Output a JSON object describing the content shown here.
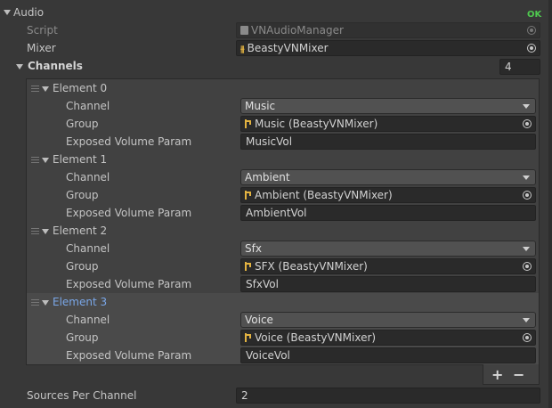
{
  "header": {
    "title": "Audio",
    "status": "OK"
  },
  "script_field": {
    "label": "Script",
    "value": "VNAudioManager"
  },
  "mixer_field": {
    "label": "Mixer",
    "value": "BeastyVNMixer"
  },
  "channels": {
    "label": "Channels",
    "size": "4",
    "elements": [
      {
        "title": "Element 0",
        "channel_label": "Channel",
        "channel": "Music",
        "group_label": "Group",
        "group": "Music (BeastyVNMixer)",
        "param_label": "Exposed Volume Param",
        "param": "MusicVol"
      },
      {
        "title": "Element 1",
        "channel_label": "Channel",
        "channel": "Ambient",
        "group_label": "Group",
        "group": "Ambient (BeastyVNMixer)",
        "param_label": "Exposed Volume Param",
        "param": "AmbientVol"
      },
      {
        "title": "Element 2",
        "channel_label": "Channel",
        "channel": "Sfx",
        "group_label": "Group",
        "group": "SFX (BeastyVNMixer)",
        "param_label": "Exposed Volume Param",
        "param": "SfxVol"
      },
      {
        "title": "Element 3",
        "channel_label": "Channel",
        "channel": "Voice",
        "group_label": "Group",
        "group": "Voice (BeastyVNMixer)",
        "param_label": "Exposed Volume Param",
        "param": "VoiceVol"
      }
    ],
    "add_label": "+",
    "remove_label": "−"
  },
  "sources": {
    "label": "Sources Per Channel",
    "value": "2"
  },
  "colors": {
    "background": "#383838",
    "field": "#2a2a2a",
    "accent_selected": "#7aa7e8",
    "ok": "#4fc94f",
    "object_icon": "#e3b341"
  }
}
